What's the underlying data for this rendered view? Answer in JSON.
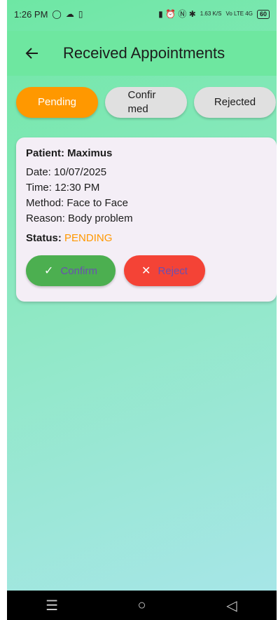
{
  "status_bar": {
    "time": "1:26 PM",
    "whatsapp_icon": "whatsapp-icon",
    "cloud_icon": "cloud-icon",
    "phone_icon": "phone-icon",
    "right_icons_glyphs": "▮ ⏰ Ⓝ ✱",
    "speed": "1.63 K/S",
    "network": "Vo LTE 4G",
    "battery": "60"
  },
  "app_bar": {
    "title": "Received Appointments",
    "back_icon": "back-arrow-icon"
  },
  "tabs": [
    {
      "label": "Pending",
      "active": true
    },
    {
      "label": "Confirmed",
      "active": false
    },
    {
      "label": "Rejected",
      "active": false
    }
  ],
  "appointment": {
    "patient": "Patient: Maximus",
    "date": "Date: 10/07/2025",
    "time": "Time: 12:30 PM",
    "method": "Method: Face to Face",
    "reason": "Reason: Body problem",
    "status_label": "Status:",
    "status_value": "PENDING",
    "confirm_label": "Confirm",
    "reject_label": "Reject"
  },
  "colors": {
    "accent_orange": "#ff9800",
    "confirm_green": "#4caf50",
    "reject_red": "#f44336",
    "button_text_purple": "#6a4fb2",
    "header_green": "#6ee7a0"
  },
  "nav_bar": {
    "menu_icon": "menu-icon",
    "home_icon": "home-circle-icon",
    "back_icon": "back-triangle-icon"
  }
}
